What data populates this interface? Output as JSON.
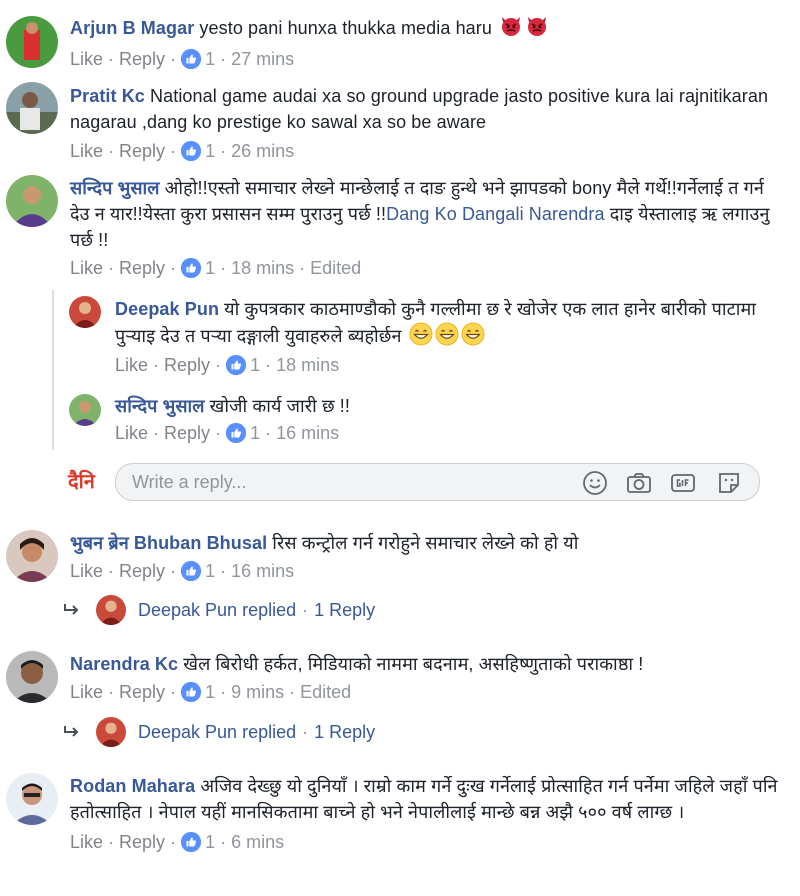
{
  "comments": [
    {
      "author": "Arjun B Magar",
      "text": " yesto pani hunxa thukka media haru ",
      "like_label": "Like",
      "reply_label": "Reply",
      "like_count": "1",
      "time": "27 mins",
      "emoji": "angry-devil-icon"
    },
    {
      "author": "Pratit Kc",
      "text": " National game audai xa so ground upgrade jasto positive kura lai rajnitikaran nagarau ,dang ko prestige ko sawal xa so be aware",
      "like_label": "Like",
      "reply_label": "Reply",
      "like_count": "1",
      "time": "26 mins"
    },
    {
      "author": "सन्दिप भुसाल",
      "text": " ओहो!!एस्तो समाचार लेख्ने मान्छेलाई त दाङ हुन्थे भने झापडको bony मैले गर्थे!!गर्नेलाई त गर्न देउ न यार!!येस्ता कुरा प्रसासन सम्म पुराउनु पर्छ !!",
      "tag": "Dang Ko Dangali Narendra",
      "text_after": " दाइ येस्तालाइ ऋ लगाउनु पर्छ !!",
      "like_label": "Like",
      "reply_label": "Reply",
      "like_count": "1",
      "time": "18 mins",
      "edited": "Edited",
      "replies": [
        {
          "author": "Deepak Pun",
          "text": " यो कुपत्रकार काठमाण्डौको कुनै गल्लीमा छ रे खोजेर एक लात हानेर बारीको पाटामा पुऱ्याइ देउ त पऱ्या दङ्गाली युवाहरुले ब्यहोर्छन ",
          "like_label": "Like",
          "reply_label": "Reply",
          "like_count": "1",
          "time": "18 mins",
          "emoji": "grinning-face-icon"
        },
        {
          "author": "सन्दिप भुसाल",
          "text": " खोजी कार्य जारी छ !!",
          "like_label": "Like",
          "reply_label": "Reply",
          "like_count": "1",
          "time": "16 mins"
        }
      ],
      "reply_box": {
        "placeholder": "Write a reply...",
        "logo_text": "दैनि"
      }
    },
    {
      "author": "भुबन ब्रेन Bhuban Bhusal",
      "text": " रिस कन्ट्रोल गर्न गरोहुने समाचार लेख्ने को हो यो",
      "like_label": "Like",
      "reply_label": "Reply",
      "like_count": "1",
      "time": "16 mins",
      "replied": {
        "text": "Deepak Pun replied",
        "count": "1 Reply"
      }
    },
    {
      "author": "Narendra Kc",
      "text": " खेल बिरोधी हर्कत, मिडियाको नाममा बदनाम, असहिष्णुताको पराकाष्ठा !",
      "like_label": "Like",
      "reply_label": "Reply",
      "like_count": "1",
      "time": "9 mins",
      "edited": "Edited",
      "replied": {
        "text": "Deepak Pun replied",
        "count": "1 Reply"
      }
    },
    {
      "author": "Rodan Mahara",
      "text": " अजिव देख्छु यो दुनियाँ । राम्रो काम गर्ने दुःख गर्नेलाई प्रोत्साहित गर्न पर्नेमा जहिले जहाँ पनि हतोत्साहित । नेपाल यहीं मानसिकतामा बाच्ने हो भने नेपालीलाई मान्छे बन्न अझै ५०० वर्ष लाग्छ ।",
      "like_label": "Like",
      "reply_label": "Reply",
      "like_count": "1",
      "time": "6 mins"
    }
  ],
  "dot": "·",
  "colors": {
    "link": "#385898",
    "meta": "#90949c",
    "like_badge": "#5890ff"
  }
}
